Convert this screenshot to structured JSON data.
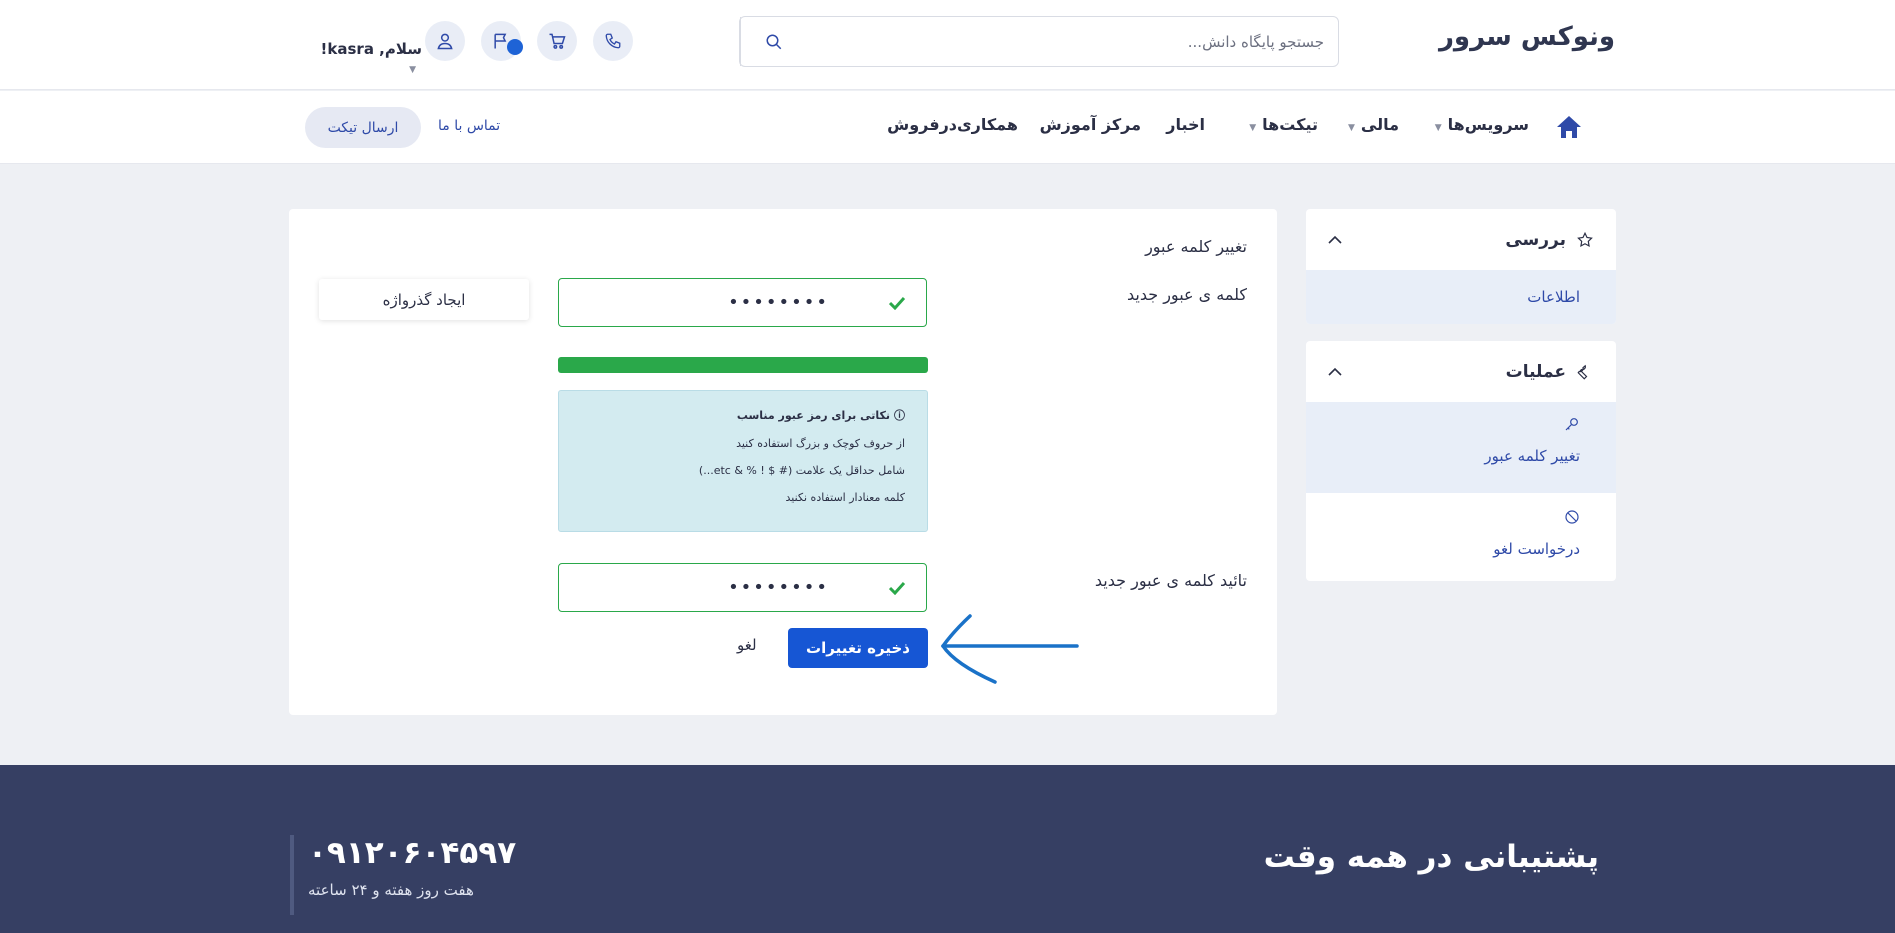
{
  "header": {
    "brand": "ونوکس سرور",
    "search_placeholder": "جستجو پایگاه دانش...",
    "greeting": "سلام, kasra!"
  },
  "nav": {
    "items": [
      {
        "label": "سرویس‌ها",
        "dropdown": true
      },
      {
        "label": "مالی",
        "dropdown": true
      },
      {
        "label": "تیکت‌ها",
        "dropdown": true
      },
      {
        "label": "اخبار",
        "dropdown": false
      },
      {
        "label": "مرکز آموزش",
        "dropdown": false
      },
      {
        "label": "همکاری‌درفروش",
        "dropdown": false
      }
    ],
    "contact": "تماس با ما",
    "send_ticket": "ارسال تیکت"
  },
  "sidebar": {
    "overview": {
      "title": "بررسی",
      "items": [
        "اطلاعات"
      ]
    },
    "actions": {
      "title": "عملیات",
      "items": [
        "تغییر کلمه عبور",
        "درخواست لغو"
      ]
    }
  },
  "form": {
    "title": "تغییر کلمه عبور",
    "new_password_label": "کلمه ی عبور جدید",
    "new_password_value": "••••••••",
    "confirm_label": "تائید کلمه ی عبور جدید",
    "confirm_value": "••••••••",
    "generate_button": "ایجاد گذرواژه",
    "strength_fraction": 1.0,
    "tips_title": "نکاتی برای رمز عبور مناسب",
    "tips": [
      "از حروف کوچک و بزرگ استفاده کنید",
      "شامل حداقل یک علامت (# $ ! % & etc...)",
      "کلمه معنادار استفاده نکنید"
    ],
    "save_button": "ذخیره تغییرات",
    "cancel": "لغو"
  },
  "footer": {
    "title": "پشتیبانی در همه وقت",
    "phone": "۰۹۱۲۰۶۰۴۵۹۷",
    "hours": "هفت روز هفته و ۲۴ ساعته"
  },
  "colors": {
    "primary": "#1656d4",
    "success": "#2aa84a",
    "footer_bg": "#363f63",
    "tips_bg": "#d3ebf0",
    "arrow": "#1a72c8"
  }
}
